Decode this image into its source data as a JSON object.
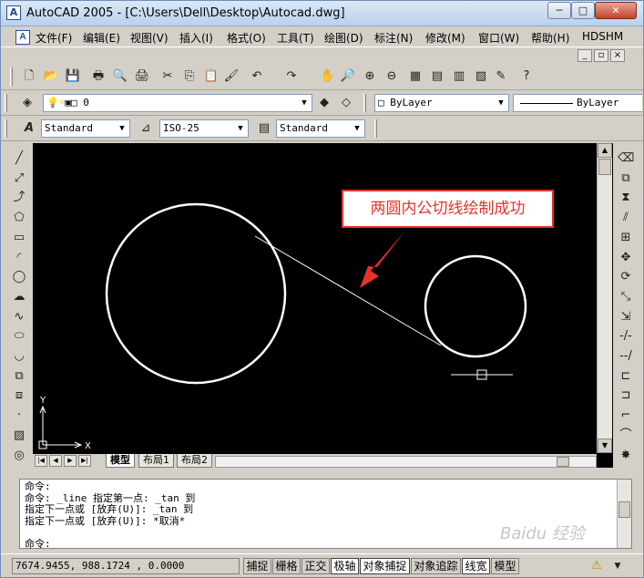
{
  "window": {
    "title": "AutoCAD 2005 - [C:\\Users\\Dell\\Desktop\\Autocad.dwg]",
    "app_icon": "A",
    "controls": {
      "minimize": "─",
      "maximize": "□",
      "close": "✕"
    }
  },
  "menu": {
    "items": [
      "文件(F)",
      "编辑(E)",
      "视图(V)",
      "插入(I)",
      "格式(O)",
      "工具(T)",
      "绘图(D)",
      "标注(N)",
      "修改(M)",
      "窗口(W)",
      "帮助(H)",
      "HDSHM"
    ]
  },
  "mdi_controls": [
    "_",
    "▫",
    "×"
  ],
  "layers": {
    "current_layer": "0",
    "color": "ByLayer",
    "linetype": "ByLayer"
  },
  "styles": {
    "text_style": "Standard",
    "dim_style": "ISO-25",
    "table_style": "Standard"
  },
  "ucs": {
    "y_label": "Y",
    "x_label": "X"
  },
  "tabs": {
    "model": "模型",
    "layout1": "布局1",
    "layout2": "布局2"
  },
  "annotation": {
    "text": "两圆内公切线绘制成功",
    "color": "#e6332a"
  },
  "command_history": [
    "命令:",
    "命令: _line 指定第一点: _tan 到",
    "指定下一点或 [放弃(U)]: _tan 到",
    "指定下一点或 [放弃(U)]: *取消*"
  ],
  "command_prompt": "命令:",
  "status": {
    "coordinates": "7674.9455, 988.1724 , 0.0000",
    "toggles": [
      {
        "label": "捕捉",
        "on": false
      },
      {
        "label": "栅格",
        "on": false
      },
      {
        "label": "正交",
        "on": false
      },
      {
        "label": "极轴",
        "on": true
      },
      {
        "label": "对象捕捉",
        "on": true
      },
      {
        "label": "对象追踪",
        "on": false
      },
      {
        "label": "线宽",
        "on": true
      },
      {
        "label": "模型",
        "on": false
      }
    ]
  },
  "watermark": "Baidu 经验",
  "icons": {
    "standard_toolbar": [
      "new-icon",
      "open-icon",
      "save-icon",
      "print-icon",
      "preview-icon",
      "publish-icon",
      "cut-icon",
      "copy-icon",
      "paste-icon",
      "matchprop-icon",
      "undo-icon",
      "redo-icon",
      "pan-icon",
      "zoom-realtime-icon",
      "zoom-window-icon",
      "zoom-previous-icon",
      "properties-icon",
      "designcenter-icon",
      "toolpalette-icon",
      "sheetset-icon",
      "markup-icon",
      "help-icon"
    ],
    "draw_toolbar": [
      "line-icon",
      "xline-icon",
      "pline-icon",
      "polygon-icon",
      "rectangle-icon",
      "arc-icon",
      "circle-icon",
      "revcloud-icon",
      "spline-icon",
      "ellipse-icon",
      "ellipse-arc-icon",
      "insert-block-icon",
      "make-block-icon",
      "point-icon",
      "hatch-icon",
      "region-icon"
    ],
    "modify_toolbar": [
      "erase-icon",
      "copy-obj-icon",
      "mirror-icon",
      "offset-icon",
      "array-icon",
      "move-icon",
      "rotate-icon",
      "scale-icon",
      "stretch-icon",
      "trim-icon",
      "extend-icon",
      "break-at-point-icon",
      "break-icon",
      "chamfer-icon",
      "fillet-icon",
      "explode-icon"
    ]
  }
}
